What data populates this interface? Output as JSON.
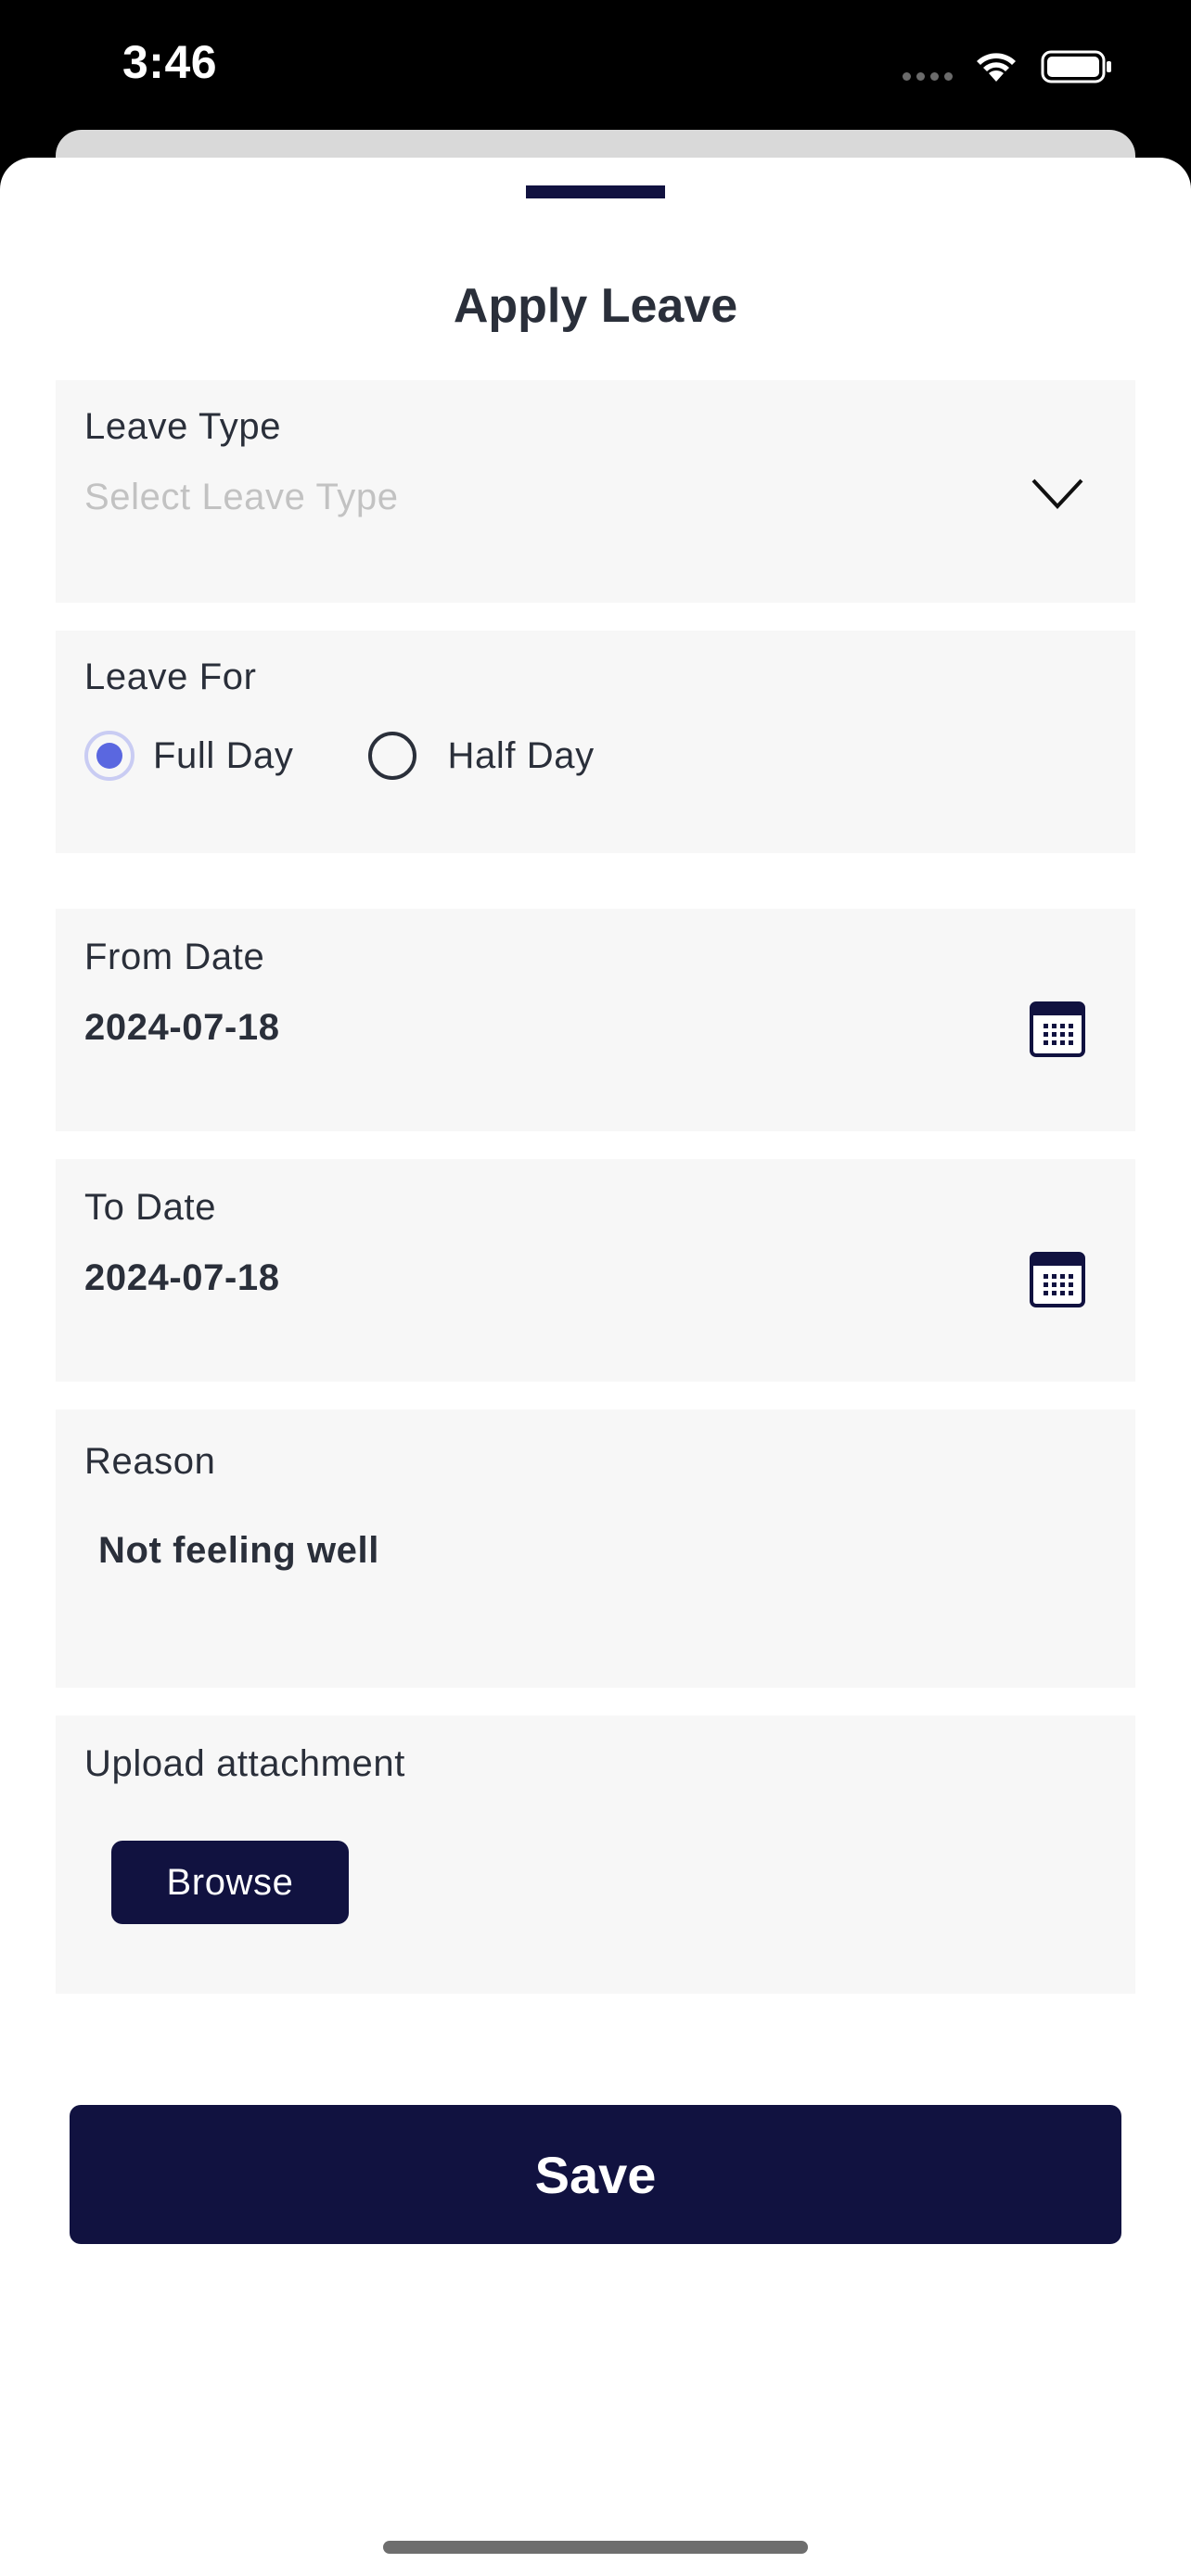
{
  "status_bar": {
    "time": "3:46"
  },
  "sheet": {
    "title": "Apply Leave"
  },
  "leave_type": {
    "label": "Leave Type",
    "placeholder": "Select Leave Type"
  },
  "leave_for": {
    "label": "Leave For",
    "options": [
      {
        "label": "Full Day",
        "selected": true
      },
      {
        "label": "Half Day",
        "selected": false
      }
    ]
  },
  "from_date": {
    "label": "From Date",
    "value": "2024-07-18"
  },
  "to_date": {
    "label": "To Date",
    "value": "2024-07-18"
  },
  "reason": {
    "label": "Reason",
    "value": "Not feeling well"
  },
  "attachment": {
    "label": "Upload attachment",
    "browse_label": "Browse"
  },
  "save_label": "Save",
  "colors": {
    "primary": "#111240",
    "radio_accent": "#5a67e0",
    "field_bg": "#f7f7f7"
  },
  "icons": [
    "chevron-down-icon",
    "calendar-icon",
    "wifi-icon",
    "battery-icon"
  ]
}
